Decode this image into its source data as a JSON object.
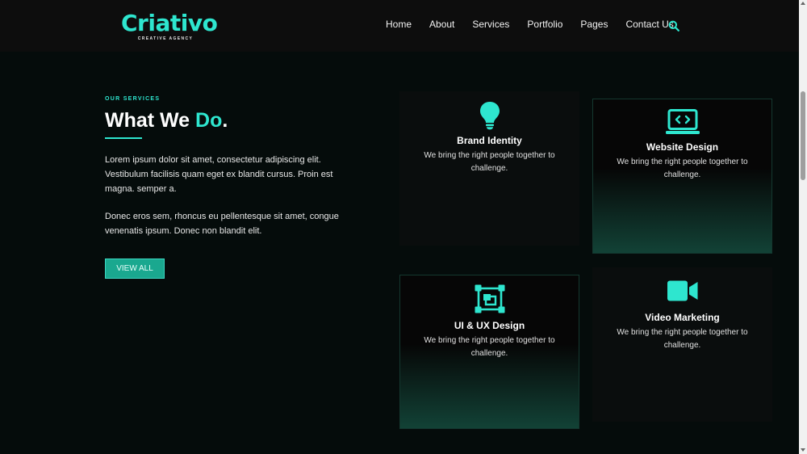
{
  "brand": {
    "name": "Criativo",
    "tagline": "CREATIVE AGENCY"
  },
  "nav": {
    "items": [
      "Home",
      "About",
      "Services",
      "Portfolio",
      "Pages",
      "Contact Us"
    ],
    "search_icon": "search-icon"
  },
  "intro": {
    "eyebrow": "OUR SERVICES",
    "heading_main": "What We ",
    "heading_accent": "Do",
    "heading_end": ".",
    "paragraph1": "Lorem ipsum dolor sit amet, consectetur adipiscing elit. Vestibulum facilisis quam eget ex blandit cursus. Proin est magna. semper a.",
    "paragraph2": "Donec eros sem, rhoncus eu pellentesque sit amet, congue venenatis ipsum. Donec non blandit elit.",
    "button_label": "VIEW ALL"
  },
  "services": [
    {
      "title": "Brand Identity",
      "description": "We bring the right people together to challenge.",
      "icon": "lightbulb-icon"
    },
    {
      "title": "Website Design",
      "description": "We bring the right people together to challenge.",
      "icon": "laptop-code-icon"
    },
    {
      "title": "UI & UX Design",
      "description": "We bring the right people together to challenge.",
      "icon": "vector-square-icon"
    },
    {
      "title": "Video Marketing",
      "description": "We bring the right people together to challenge.",
      "icon": "video-camera-icon"
    }
  ],
  "colors": {
    "accent": "#2ee6cf",
    "button": "#1aa88f",
    "background": "#050c0b",
    "header": "#0d0d0d"
  }
}
